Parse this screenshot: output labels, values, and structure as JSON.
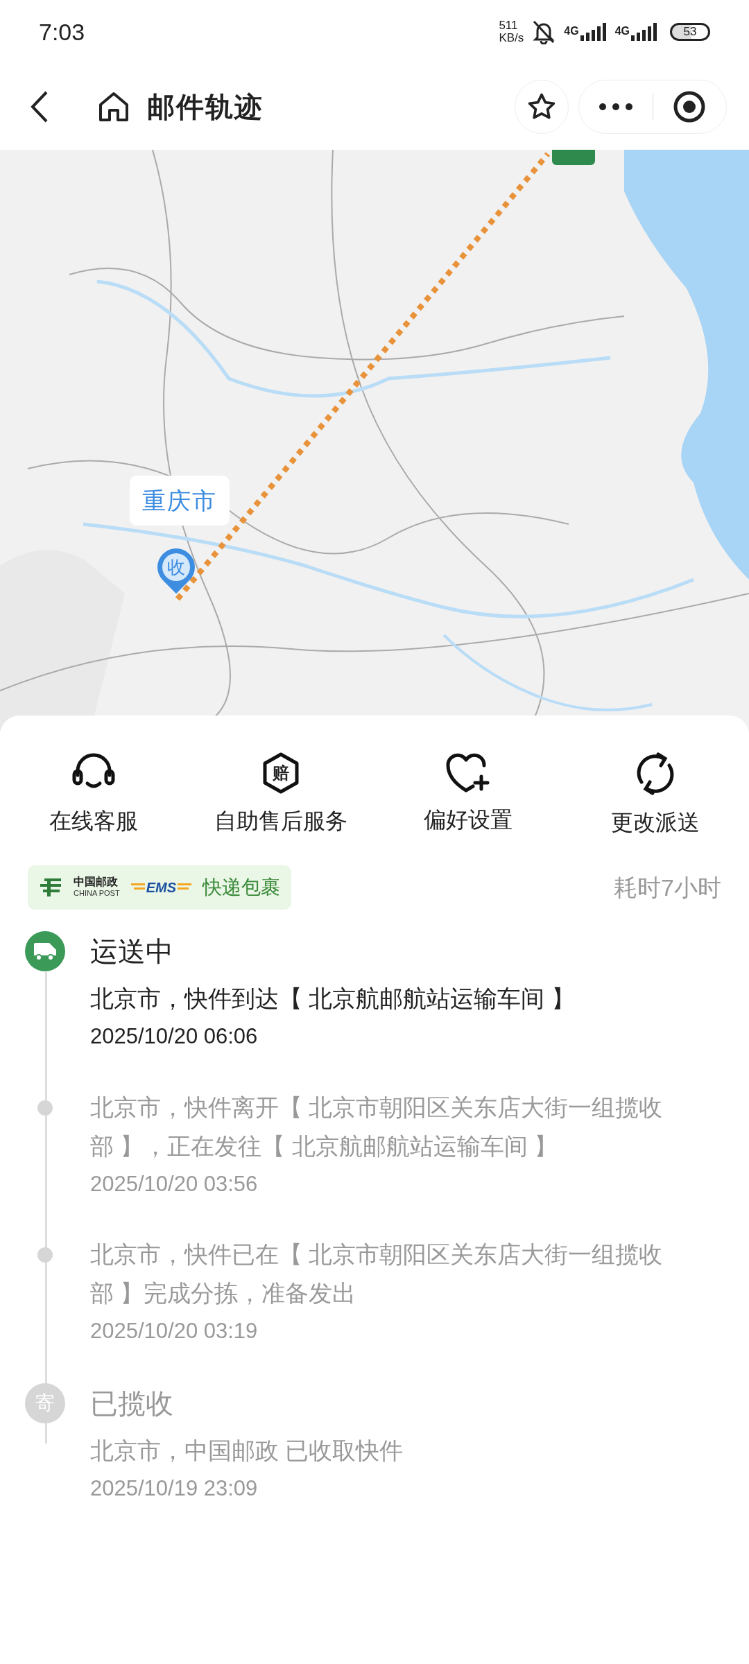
{
  "status_bar": {
    "time": "7:03",
    "speed_value": "511",
    "speed_unit": "KB/s",
    "network_labels": [
      "4G",
      "4G"
    ],
    "battery": "53"
  },
  "header": {
    "title": "邮件轨迹"
  },
  "map": {
    "callout": "重庆市",
    "pin_label": "收"
  },
  "services": [
    {
      "label": "在线客服"
    },
    {
      "glyph": "赔",
      "label": "自助售后服务"
    },
    {
      "label": "偏好设置"
    },
    {
      "label": "更改派送"
    }
  ],
  "carrier": {
    "name_cn": "中国邮政",
    "name_en": "CHINA POST",
    "brand": "EMS",
    "service": "快递包裹"
  },
  "duration": "耗时7小时",
  "timeline": [
    {
      "kind": "status",
      "title": "运送中",
      "current": true
    },
    {
      "kind": "step",
      "text": "北京市，快件到达【 北京航邮航站运输车间 】",
      "time": "2025/10/20 06:06",
      "current": true
    },
    {
      "kind": "step",
      "text": "北京市，快件离开【 北京市朝阳区关东店大街一组揽收部 】，正在发往【 北京航邮航站运输车间 】",
      "time": "2025/10/20 03:56",
      "current": false
    },
    {
      "kind": "step",
      "text": "北京市，快件已在【 北京市朝阳区关东店大街一组揽收部 】完成分拣，准备发出",
      "time": "2025/10/20 03:19",
      "current": false
    },
    {
      "kind": "status",
      "title": "已揽收",
      "glyph": "寄",
      "current": false
    },
    {
      "kind": "step",
      "text": "北京市，中国邮政 已收取快件",
      "time": "2025/10/19 23:09",
      "current": false
    }
  ]
}
